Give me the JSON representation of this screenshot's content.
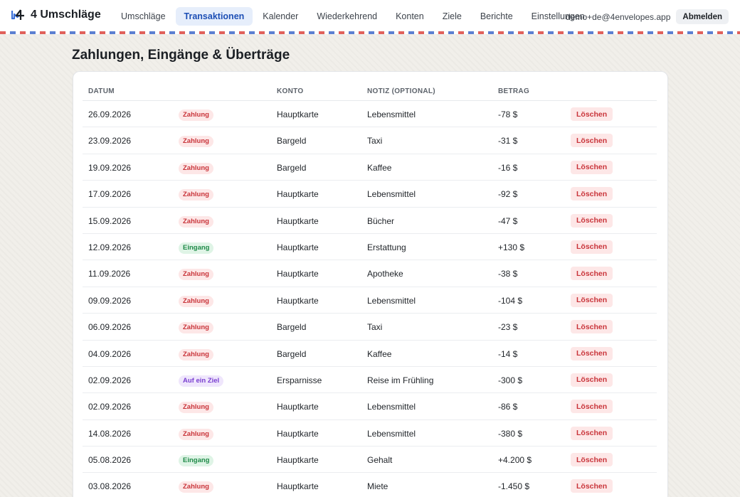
{
  "app": {
    "title": "4 Umschläge"
  },
  "nav": {
    "tabs": [
      {
        "label": "Umschläge",
        "active": false
      },
      {
        "label": "Transaktionen",
        "active": true
      },
      {
        "label": "Kalender",
        "active": false
      },
      {
        "label": "Wiederkehrend",
        "active": false
      },
      {
        "label": "Konten",
        "active": false
      },
      {
        "label": "Ziele",
        "active": false
      },
      {
        "label": "Berichte",
        "active": false
      },
      {
        "label": "Einstellungen",
        "active": false
      }
    ]
  },
  "account": {
    "email": "demo+de@4envelopes.app",
    "logout_label": "Abmelden"
  },
  "page": {
    "title": "Zahlungen, Eingänge & Überträge"
  },
  "colors": {
    "accent": "#1d4fb5",
    "payment": "#c9343a",
    "income": "#1f8a48",
    "goal": "#7a3fd1"
  },
  "table": {
    "headers": {
      "date": "DATUM",
      "type": "",
      "account": "KONTO",
      "note": "NOTIZ (OPTIONAL)",
      "amount": "BETRAG"
    },
    "delete_label": "Löschen",
    "rows": [
      {
        "date": "26.09.2026",
        "type": "Zahlung",
        "kind": "pay",
        "account": "Hauptkarte",
        "note": "Lebensmittel",
        "amount": "-78 $"
      },
      {
        "date": "23.09.2026",
        "type": "Zahlung",
        "kind": "pay",
        "account": "Bargeld",
        "note": "Taxi",
        "amount": "-31 $"
      },
      {
        "date": "19.09.2026",
        "type": "Zahlung",
        "kind": "pay",
        "account": "Bargeld",
        "note": "Kaffee",
        "amount": "-16 $"
      },
      {
        "date": "17.09.2026",
        "type": "Zahlung",
        "kind": "pay",
        "account": "Hauptkarte",
        "note": "Lebensmittel",
        "amount": "-92 $"
      },
      {
        "date": "15.09.2026",
        "type": "Zahlung",
        "kind": "pay",
        "account": "Hauptkarte",
        "note": "Bücher",
        "amount": "-47 $"
      },
      {
        "date": "12.09.2026",
        "type": "Eingang",
        "kind": "income",
        "account": "Hauptkarte",
        "note": "Erstattung",
        "amount": "+130 $"
      },
      {
        "date": "11.09.2026",
        "type": "Zahlung",
        "kind": "pay",
        "account": "Hauptkarte",
        "note": "Apotheke",
        "amount": "-38 $"
      },
      {
        "date": "09.09.2026",
        "type": "Zahlung",
        "kind": "pay",
        "account": "Hauptkarte",
        "note": "Lebensmittel",
        "amount": "-104 $"
      },
      {
        "date": "06.09.2026",
        "type": "Zahlung",
        "kind": "pay",
        "account": "Bargeld",
        "note": "Taxi",
        "amount": "-23 $"
      },
      {
        "date": "04.09.2026",
        "type": "Zahlung",
        "kind": "pay",
        "account": "Bargeld",
        "note": "Kaffee",
        "amount": "-14 $"
      },
      {
        "date": "02.09.2026",
        "type": "Auf ein Ziel",
        "kind": "goal",
        "account": "Ersparnisse",
        "note": "Reise im Frühling",
        "amount": "-300 $"
      },
      {
        "date": "02.09.2026",
        "type": "Zahlung",
        "kind": "pay",
        "account": "Hauptkarte",
        "note": "Lebensmittel",
        "amount": "-86 $"
      },
      {
        "date": "14.08.2026",
        "type": "Zahlung",
        "kind": "pay",
        "account": "Hauptkarte",
        "note": "Lebensmittel",
        "amount": "-380 $"
      },
      {
        "date": "05.08.2026",
        "type": "Eingang",
        "kind": "income",
        "account": "Hauptkarte",
        "note": "Gehalt",
        "amount": "+4.200 $"
      },
      {
        "date": "03.08.2026",
        "type": "Zahlung",
        "kind": "pay",
        "account": "Hauptkarte",
        "note": "Miete",
        "amount": "-1.450 $"
      }
    ]
  }
}
